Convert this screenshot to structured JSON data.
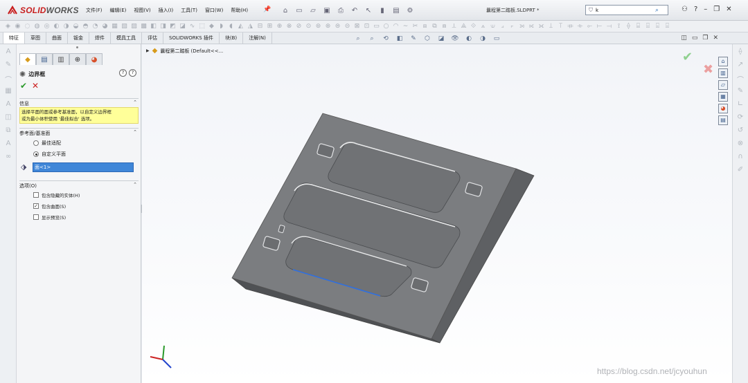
{
  "app": {
    "brand_prefix": "SOLID",
    "brand_suffix": "WORKS",
    "document_title": "曩程第二踏板.SLDPRT *"
  },
  "menu": [
    "文件(F)",
    "编辑(E)",
    "视图(V)",
    "插入(I)",
    "工具(T)",
    "窗口(W)",
    "帮助(H)"
  ],
  "search": {
    "value": "k"
  },
  "tabs": [
    "特征",
    "草图",
    "曲面",
    "钣金",
    "焊件",
    "模具工具",
    "评估",
    "SOLIDWORKS 插件",
    "块(B)",
    "注解(N)"
  ],
  "active_tab": "特征",
  "property_manager": {
    "title": "边界框",
    "info": {
      "heading": "信息",
      "message_line1": "选择平面的面或参考基准面，以自定义边界框",
      "message_line2": "或为最小体积使用 '最佳拟合' 选项。"
    },
    "reference": {
      "heading": "参考面/基准面",
      "best_fit": "最佳适配",
      "custom_plane": "自定义平面",
      "selected_face": "面<1>"
    },
    "options": {
      "heading": "选项(O)",
      "include_hidden": "包含隐藏的实体(H)",
      "include_surfaces": "包含曲面(S)",
      "show_preview": "显示预览(S)"
    }
  },
  "feature_tree": {
    "root_label": "曩程第二踏板  (Default<<..."
  },
  "watermark": "https://blog.csdn.net/jcyouhun",
  "colors": {
    "brand_red": "#c81e1e",
    "selection_blue": "#3f86d8",
    "info_yellow": "#ffff99",
    "model_gray": "#7b7d80",
    "ok_green": "#2c9a2c",
    "cancel_red": "#cc2222"
  }
}
